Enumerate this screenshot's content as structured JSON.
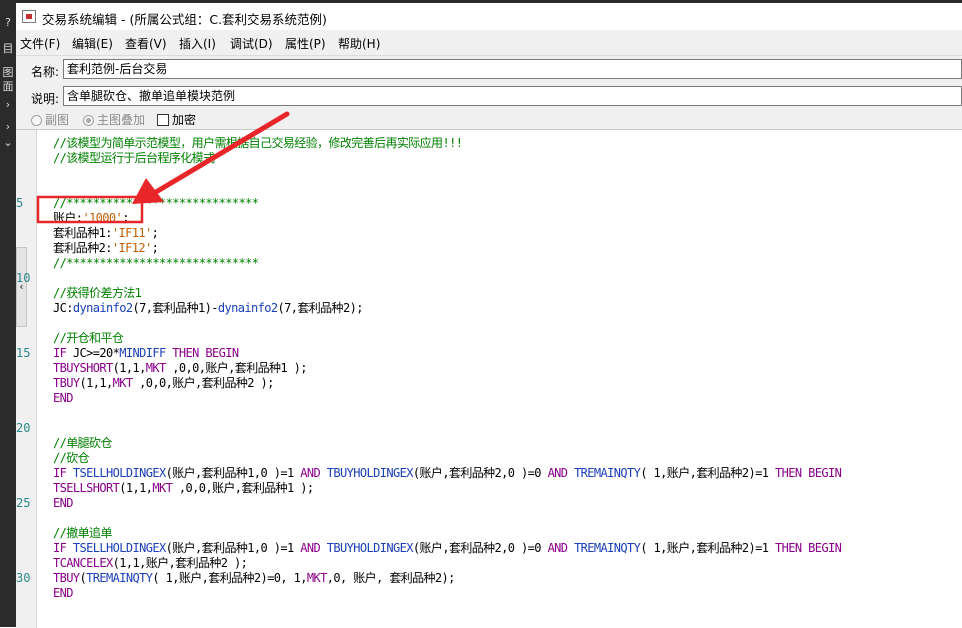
{
  "window": {
    "title": "交易系统编辑 - (所属公式组：C.套利交易系统范例)"
  },
  "host": {
    "left_glyphs": [
      "?",
      "目",
      "图",
      "面",
      "›",
      "›",
      "⌄"
    ]
  },
  "menu": {
    "items": [
      "文件(F)",
      "编辑(E)",
      "查看(V)",
      "插入(I)",
      "调试(D)",
      "属性(P)",
      "帮助(H)"
    ]
  },
  "form": {
    "name_label": "名称:",
    "name_value": "套利范例-后台交易",
    "desc_label": "说明:",
    "desc_value": "含单腿砍仓、撤单追单模块范例"
  },
  "options": {
    "sub_chart": "副图",
    "main_overlay": "主图叠加",
    "encrypt": "加密"
  },
  "editor": {
    "collapse_glyph": "‹",
    "line_numbers": [
      {
        "label": "5",
        "line": 4
      },
      {
        "label": "10",
        "line": 9
      },
      {
        "label": "15",
        "line": 14
      },
      {
        "label": "20",
        "line": 19
      },
      {
        "label": "25",
        "line": 24
      },
      {
        "label": "30",
        "line": 29
      }
    ],
    "lines": [
      [
        {
          "t": "cm",
          "s": "//该模型为简单示范模型，用户需根据自己交易经验，修改完善后再实际应用!!!"
        }
      ],
      [
        {
          "t": "cm",
          "s": "//该模型运行于后台程序化模式"
        }
      ],
      [],
      [],
      [
        {
          "t": "cm",
          "s": "//*****************************"
        }
      ],
      [
        {
          "t": "tx",
          "s": "账户:"
        },
        {
          "t": "st",
          "s": "'1000'"
        },
        {
          "t": "tx",
          "s": ";"
        }
      ],
      [
        {
          "t": "tx",
          "s": "套利品种1:"
        },
        {
          "t": "st",
          "s": "'IF11'"
        },
        {
          "t": "tx",
          "s": ";"
        }
      ],
      [
        {
          "t": "tx",
          "s": "套利品种2:"
        },
        {
          "t": "st",
          "s": "'IF12'"
        },
        {
          "t": "tx",
          "s": ";"
        }
      ],
      [
        {
          "t": "cm",
          "s": "//*****************************"
        }
      ],
      [],
      [
        {
          "t": "cm",
          "s": "//获得价差方法1"
        }
      ],
      [
        {
          "t": "tx",
          "s": "JC:"
        },
        {
          "t": "fn",
          "s": "dynainfo2"
        },
        {
          "t": "tx",
          "s": "(7,套利品种1)-"
        },
        {
          "t": "fn",
          "s": "dynainfo2"
        },
        {
          "t": "tx",
          "s": "(7,套利品种2);"
        }
      ],
      [],
      [
        {
          "t": "cm",
          "s": "//开仓和平仓"
        }
      ],
      [
        {
          "t": "kw",
          "s": "IF"
        },
        {
          "t": "tx",
          "s": " JC>=20*"
        },
        {
          "t": "fn",
          "s": "MINDIFF"
        },
        {
          "t": "tx",
          "s": " "
        },
        {
          "t": "kw",
          "s": "THEN BEGIN"
        }
      ],
      [
        {
          "t": "sf",
          "s": "TBUYSHORT"
        },
        {
          "t": "tx",
          "s": "(1,1,"
        },
        {
          "t": "sf",
          "s": "MKT"
        },
        {
          "t": "tx",
          "s": " ,0,0,账户,套利品种1 );"
        }
      ],
      [
        {
          "t": "sf",
          "s": "TBUY"
        },
        {
          "t": "tx",
          "s": "(1,1,"
        },
        {
          "t": "sf",
          "s": "MKT"
        },
        {
          "t": "tx",
          "s": " ,0,0,账户,套利品种2 );"
        }
      ],
      [
        {
          "t": "kw",
          "s": "END"
        }
      ],
      [],
      [],
      [
        {
          "t": "cm",
          "s": "//单腿砍仓"
        }
      ],
      [
        {
          "t": "cm",
          "s": "//砍仓"
        }
      ],
      [
        {
          "t": "kw",
          "s": "IF"
        },
        {
          "t": "tx",
          "s": " "
        },
        {
          "t": "fn",
          "s": "TSELLHOLDINGEX"
        },
        {
          "t": "tx",
          "s": "(账户,套利品种1,0 )=1 "
        },
        {
          "t": "kw",
          "s": "AND"
        },
        {
          "t": "tx",
          "s": " "
        },
        {
          "t": "fn",
          "s": "TBUYHOLDINGEX"
        },
        {
          "t": "tx",
          "s": "(账户,套利品种2,0 )=0 "
        },
        {
          "t": "kw",
          "s": "AND"
        },
        {
          "t": "tx",
          "s": " "
        },
        {
          "t": "fn",
          "s": "TREMAINQTY"
        },
        {
          "t": "tx",
          "s": "( 1,账户,套利品种2)=1 "
        },
        {
          "t": "kw",
          "s": "THEN BEGIN"
        }
      ],
      [
        {
          "t": "sf",
          "s": "TSELLSHORT"
        },
        {
          "t": "tx",
          "s": "(1,1,"
        },
        {
          "t": "sf",
          "s": "MKT"
        },
        {
          "t": "tx",
          "s": " ,0,0,账户,套利品种1 );"
        }
      ],
      [
        {
          "t": "kw",
          "s": "END"
        }
      ],
      [],
      [
        {
          "t": "cm",
          "s": "//撤单追单"
        }
      ],
      [
        {
          "t": "kw",
          "s": "IF"
        },
        {
          "t": "tx",
          "s": " "
        },
        {
          "t": "fn",
          "s": "TSELLHOLDINGEX"
        },
        {
          "t": "tx",
          "s": "(账户,套利品种1,0 )=1 "
        },
        {
          "t": "kw",
          "s": "AND"
        },
        {
          "t": "tx",
          "s": " "
        },
        {
          "t": "fn",
          "s": "TBUYHOLDINGEX"
        },
        {
          "t": "tx",
          "s": "(账户,套利品种2,0 )=0 "
        },
        {
          "t": "kw",
          "s": "AND"
        },
        {
          "t": "tx",
          "s": " "
        },
        {
          "t": "fn",
          "s": "TREMAINQTY"
        },
        {
          "t": "tx",
          "s": "( 1,账户,套利品种2)=1 "
        },
        {
          "t": "kw",
          "s": "THEN BEGIN"
        }
      ],
      [
        {
          "t": "sf",
          "s": "TCANCELEX"
        },
        {
          "t": "tx",
          "s": "(1,1,账户,套利品种2 );"
        }
      ],
      [
        {
          "t": "sf",
          "s": "TBUY"
        },
        {
          "t": "tx",
          "s": "("
        },
        {
          "t": "fn",
          "s": "TREMAINQTY"
        },
        {
          "t": "tx",
          "s": "( 1,账户,套利品种2)=0, 1,"
        },
        {
          "t": "sf",
          "s": "MKT"
        },
        {
          "t": "tx",
          "s": ",0, 账户, 套利品种2);"
        }
      ],
      [
        {
          "t": "kw",
          "s": "END"
        }
      ]
    ]
  },
  "colors": {
    "annotation": "#e8262a",
    "comment": "#008000",
    "keyword": "#8b008b",
    "function": "#1a3fb8",
    "string": "#c06000",
    "line_number": "#2a8a8a"
  }
}
